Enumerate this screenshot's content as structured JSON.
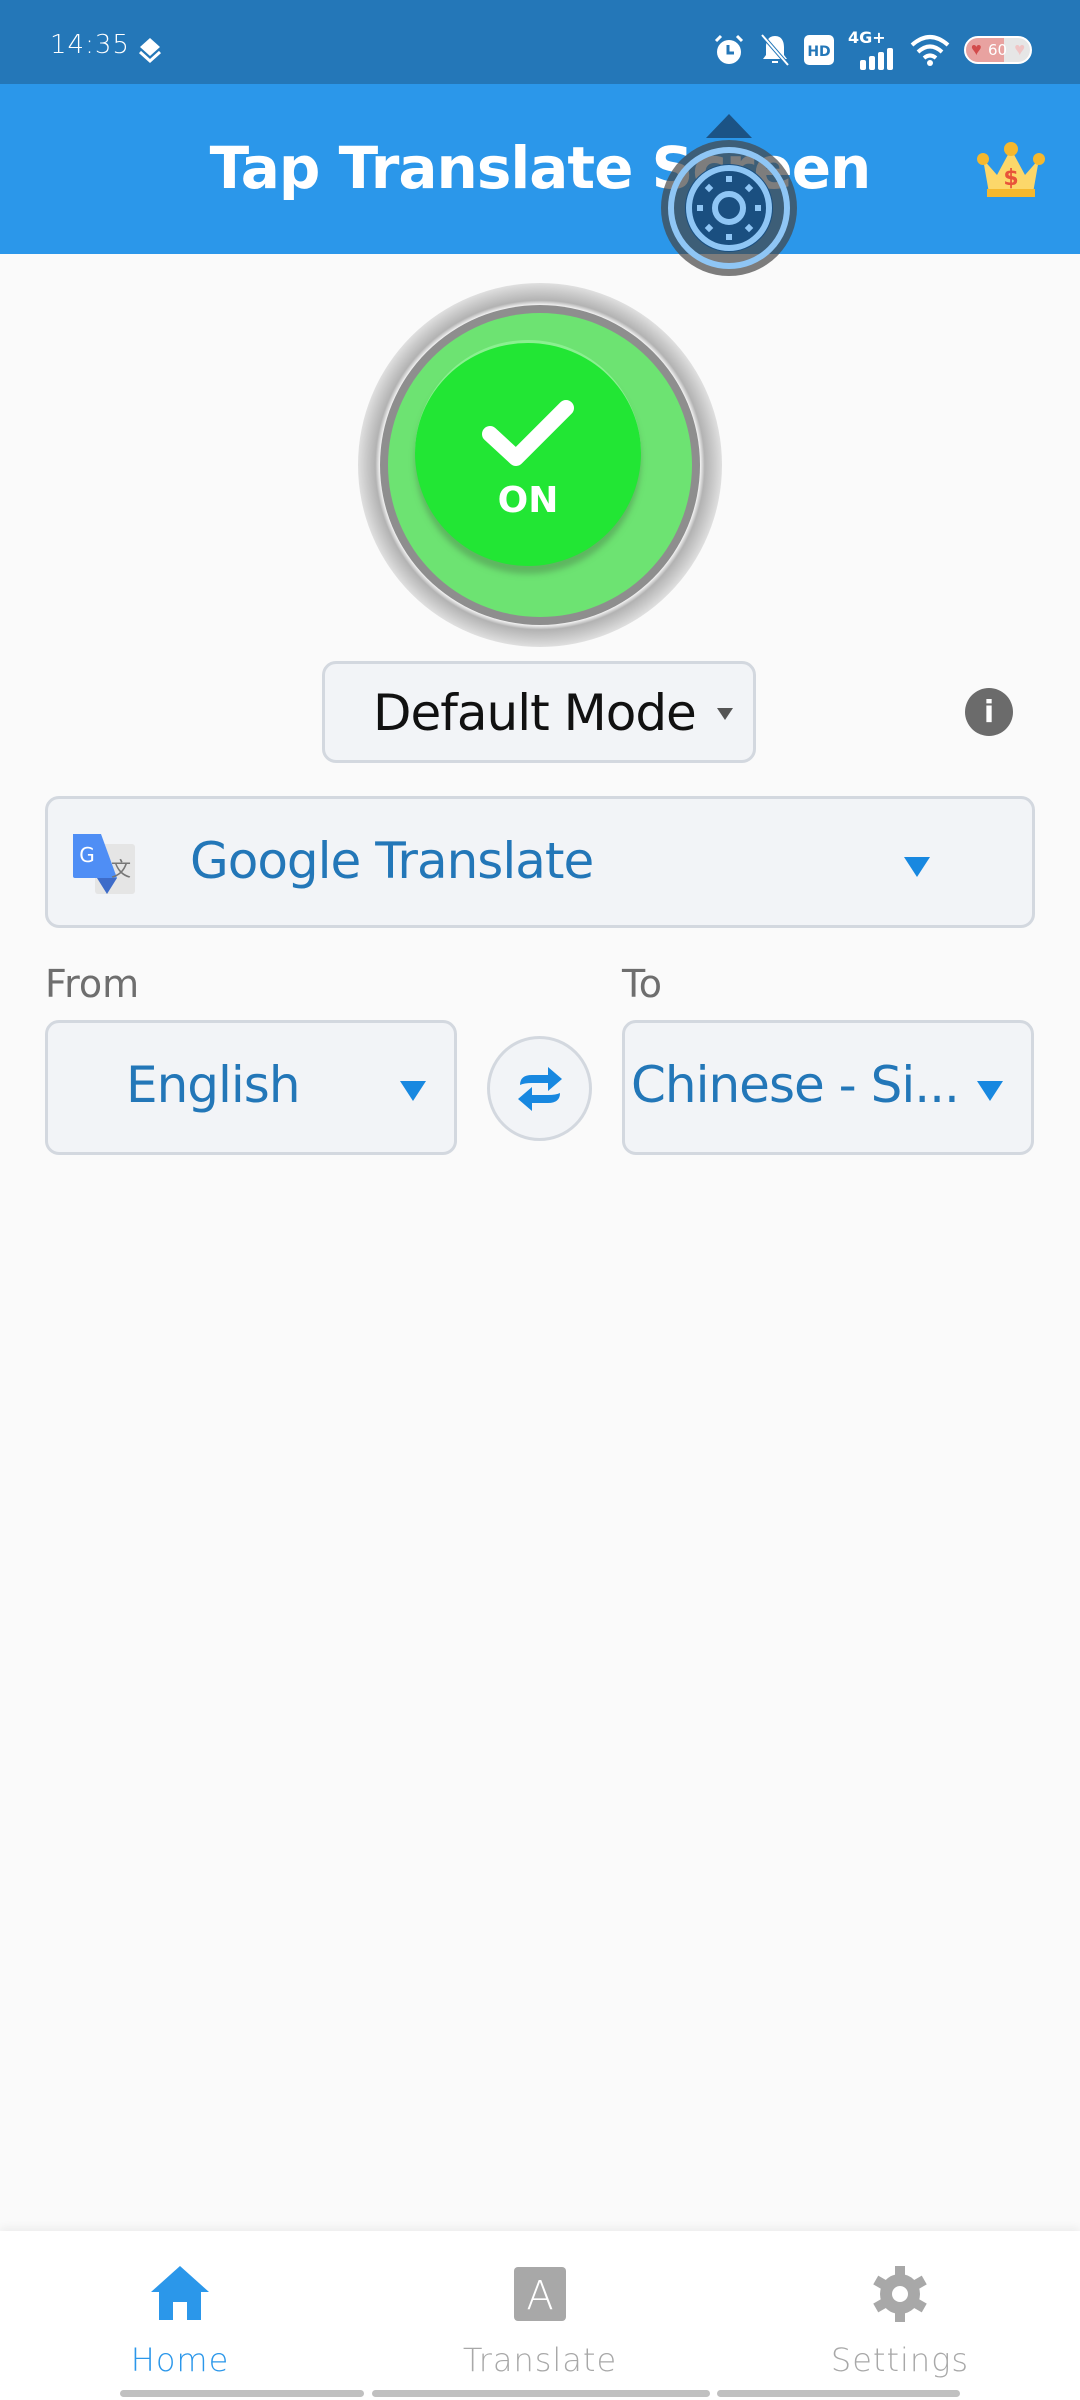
{
  "status_bar": {
    "time": "14:35",
    "network": "4G+",
    "hd_label": "HD",
    "battery_level": "60",
    "icons": [
      "layers-icon",
      "alarm-icon",
      "bell-off-icon",
      "hd-icon",
      "signal-icon",
      "wifi-icon",
      "battery-icon"
    ]
  },
  "app_bar": {
    "title": "Tap Translate Screen",
    "premium_icon": "crown-icon"
  },
  "overlay": {
    "icon": "target-icon"
  },
  "power_toggle": {
    "state_label": "ON",
    "icon": "check-icon",
    "colors": {
      "outer": "#6de372",
      "inner": "#22e634"
    }
  },
  "mode": {
    "selected": "Default Mode",
    "info_icon_label": "i"
  },
  "engine": {
    "selected": "Google Translate",
    "icon": "google-translate-icon"
  },
  "languages": {
    "from_label": "From",
    "to_label": "To",
    "from_value": "English",
    "to_value": "Chinese - Si...",
    "swap_icon": "swap-icon"
  },
  "bottom_nav": {
    "items": [
      {
        "label": "Home",
        "icon": "home-icon",
        "active": true
      },
      {
        "label": "Translate",
        "icon": "translate-icon",
        "active": false
      },
      {
        "label": "Settings",
        "icon": "gear-icon",
        "active": false
      }
    ]
  },
  "colors": {
    "status_bar": "#2477b8",
    "app_bar": "#2b97ea",
    "accent_text": "#2377b8",
    "caret": "#1888e0",
    "inactive": "#a8a8a8"
  }
}
